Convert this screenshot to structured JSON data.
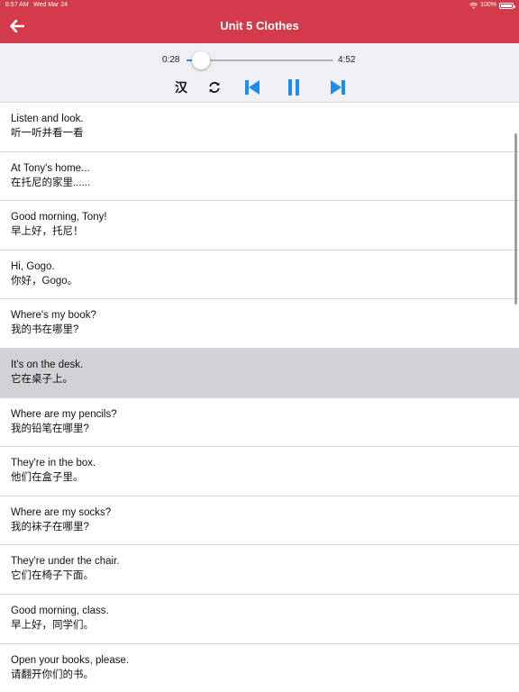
{
  "status": {
    "time": "8:57 AM",
    "date": "Wed Mar 24",
    "battery": "100%"
  },
  "header": {
    "title": "Unit 5 Clothes"
  },
  "player": {
    "current_time": "0:28",
    "total_time": "4:52",
    "progress": 0.097,
    "han_label": "汉"
  },
  "colors": {
    "header": "#d33a4a",
    "accent": "#1a8ff0",
    "selected_row": "#d1d1d6"
  },
  "sentences": [
    {
      "en": "Listen and look.",
      "zh": "听一听并看一看"
    },
    {
      "en": "At Tony's home...",
      "zh": "在托尼的家里......"
    },
    {
      "en": "Good morning, Tony!",
      "zh": "早上好，托尼！"
    },
    {
      "en": "Hi, Gogo.",
      "zh": "你好，Gogo。"
    },
    {
      "en": "Where's my book?",
      "zh": "我的书在哪里?"
    },
    {
      "en": "It's on the desk.",
      "zh": "它在桌子上。",
      "selected": true
    },
    {
      "en": "Where are my pencils?",
      "zh": "我的铅笔在哪里?"
    },
    {
      "en": "They're in the box.",
      "zh": "他们在盒子里。"
    },
    {
      "en": "Where are my socks?",
      "zh": "我的袜子在哪里?"
    },
    {
      "en": "They're under the chair.",
      "zh": "它们在椅子下面。"
    },
    {
      "en": "Good morning, class.",
      "zh": "早上好，同学们。"
    },
    {
      "en": "Open your books, please.",
      "zh": "请翻开你们的书。"
    }
  ],
  "icons": {
    "back": "arrow-left-icon",
    "repeat": "repeat-icon",
    "prev": "skip-previous-icon",
    "pause": "pause-icon",
    "next": "skip-next-icon"
  }
}
